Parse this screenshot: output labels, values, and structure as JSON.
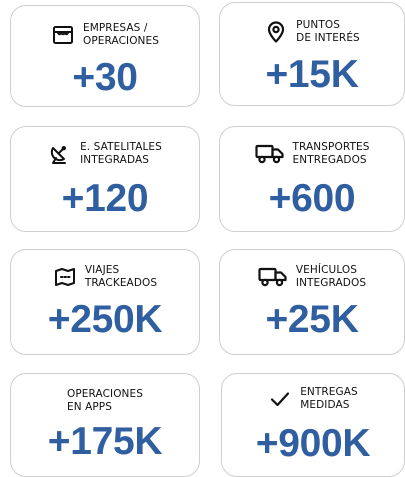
{
  "accent_color": "#2f5fa0",
  "stats": [
    {
      "label_line1": "EMPRESAS /",
      "label_line2": "OPERACIONES",
      "value": "+30",
      "icon": "storefront-icon"
    },
    {
      "label_line1": "PUNTOS",
      "label_line2": "DE INTERÉS",
      "value": "+15K",
      "icon": "location-pin-icon"
    },
    {
      "label_line1": "E. SATELITALES",
      "label_line2": "INTEGRADAS",
      "value": "+120",
      "icon": "satellite-dish-icon"
    },
    {
      "label_line1": "TRANSPORTES",
      "label_line2": "ENTREGADOS",
      "value": "+600",
      "icon": "truck-icon"
    },
    {
      "label_line1": "VIAJES",
      "label_line2": "TRACKEADOS",
      "value": "+250K",
      "icon": "map-icon"
    },
    {
      "label_line1": "VEHÍCULOS",
      "label_line2": "INTEGRADOS",
      "value": "+25K",
      "icon": "truck-icon"
    },
    {
      "label_line1": "OPERACIONES",
      "label_line2": "EN APPS",
      "value": "+175K",
      "icon": ""
    },
    {
      "label_line1": "ENTREGAS",
      "label_line2": "MEDIDAS",
      "value": "+900K",
      "icon": "checkmark-icon"
    }
  ]
}
